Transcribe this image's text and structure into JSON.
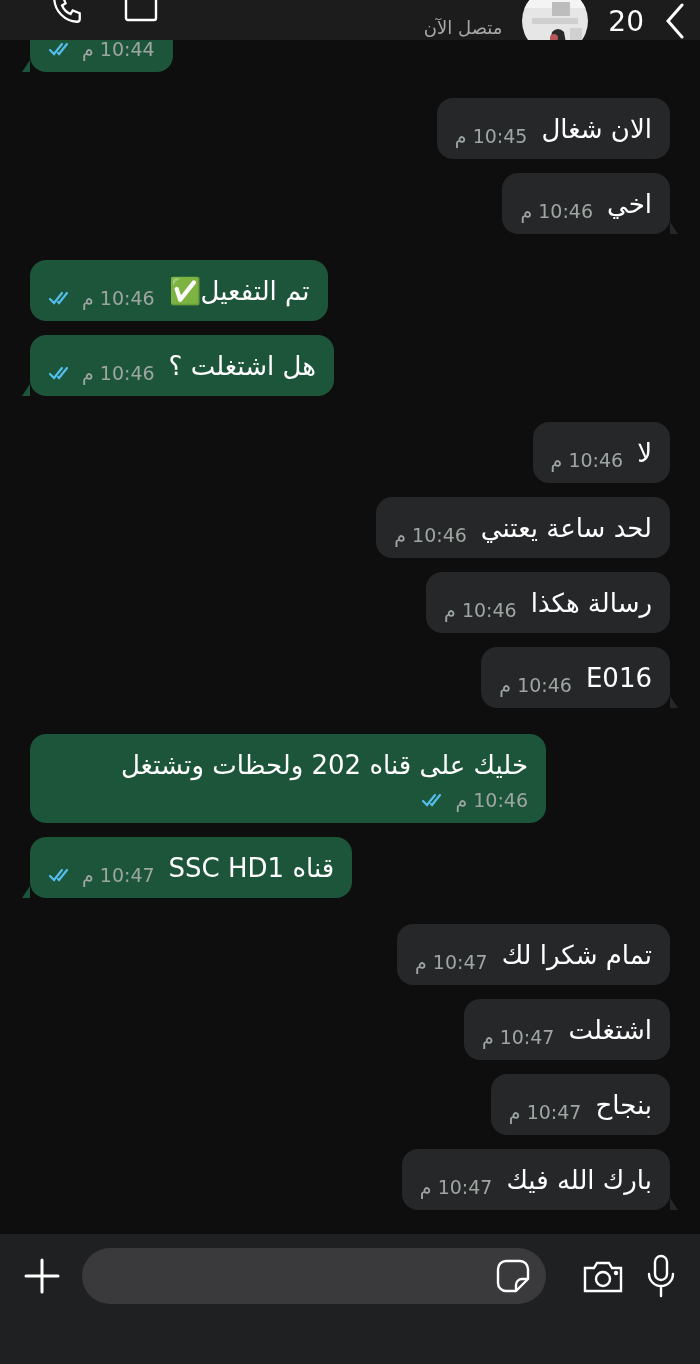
{
  "header": {
    "unread_count": "20",
    "status": "متصل الآن"
  },
  "messages": [
    {
      "kind": "sent",
      "time": "10:44 م",
      "tail": true
    },
    {
      "kind": "received",
      "text": "الان شغال",
      "time": "10:45 م",
      "tail": false
    },
    {
      "kind": "received",
      "text": "اخي",
      "time": "10:46 م",
      "tail": true
    },
    {
      "kind": "sent",
      "text": "تم التفعيل✅",
      "time": "10:46 م",
      "tail": false
    },
    {
      "kind": "sent",
      "text": "هل اشتغلت ؟",
      "time": "10:46 م",
      "tail": true
    },
    {
      "kind": "received",
      "text": "لا",
      "time": "10:46 م",
      "tail": false
    },
    {
      "kind": "received",
      "text": "لحد ساعة يعتني",
      "time": "10:46 م",
      "tail": false
    },
    {
      "kind": "received",
      "text": "رسالة هكذا",
      "time": "10:46 م",
      "tail": false
    },
    {
      "kind": "received",
      "text": "E016",
      "time": "10:46 م",
      "tail": true
    },
    {
      "kind": "sent",
      "text": "خليك على قناه 202 ولحظات وتشتغل",
      "time": "10:46 م",
      "tail": false
    },
    {
      "kind": "sent",
      "text": "قناه SSC HD1",
      "time": "10:47 م",
      "tail": true
    },
    {
      "kind": "received",
      "text": "تمام شكرا لك",
      "time": "10:47 م",
      "tail": false
    },
    {
      "kind": "received",
      "text": "اشتغلت",
      "time": "10:47 م",
      "tail": false
    },
    {
      "kind": "received",
      "text": "بنجاح",
      "time": "10:47 م",
      "tail": false
    },
    {
      "kind": "received",
      "text": "بارك الله فيك",
      "time": "10:47 م",
      "tail": true
    }
  ]
}
